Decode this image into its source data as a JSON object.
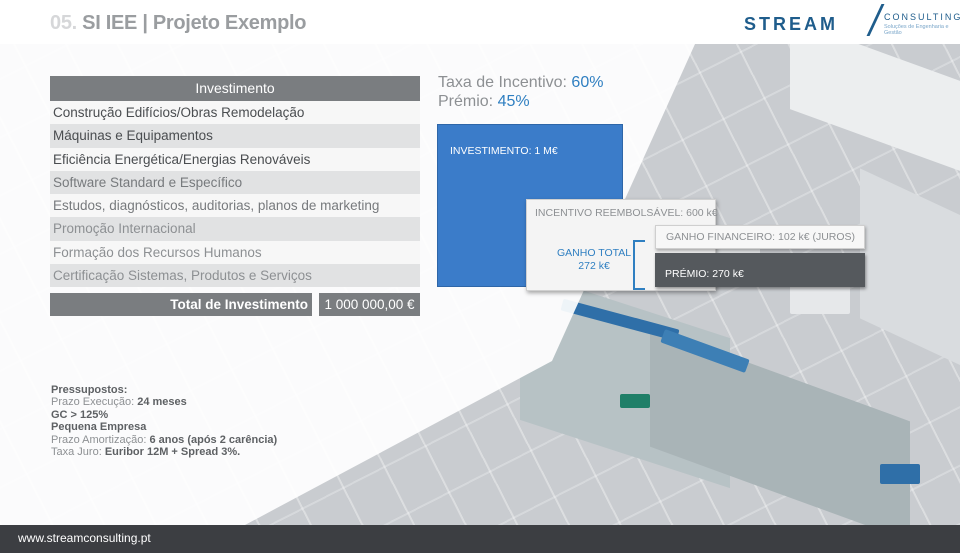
{
  "header": {
    "title_number": "05.",
    "title_text": "SI IEE | Projeto Exemplo",
    "logo_main": "STREAM",
    "logo_sub": "CONSULTING",
    "logo_tagline": "Soluções de Engenharia e Gestão"
  },
  "investment_table": {
    "heading": "Investimento",
    "rows": [
      "Construção Edifícios/Obras Remodelação",
      "Máquinas e Equipamentos",
      "Eficiência Energética/Energias Renováveis",
      "Software Standard e Específico",
      "Estudos, diagnósticos, auditorias, planos de marketing",
      "Promoção Internacional",
      "Formação dos Recursos Humanos",
      "Certificação Sistemas, Produtos e Serviços"
    ],
    "total_label": "Total de Investimento",
    "total_value": "1 000 000,00 €"
  },
  "incentive": {
    "taxa_label": "Taxa de Incentivo: ",
    "taxa_value": "60%",
    "premio_label": "Prémio: ",
    "premio_value": "45%"
  },
  "bars": {
    "investimento": "INVESTIMENTO: 1 M€",
    "incentivo": "INCENTIVO  REEMBOLSÁVEL: 600 k€",
    "ganho_total_line1": "GANHO TOTAL",
    "ganho_total_line2": "272 k€",
    "ganho_financeiro": "GANHO FINANCEIRO: 102 k€ (JUROS)",
    "premio": "PRÉMIO: 270 k€"
  },
  "pressupostos": {
    "title": "Pressupostos:",
    "prazo_label": "Prazo Execução: ",
    "prazo_value": "24 meses",
    "gc": "GC > 125%",
    "empresa": "Pequena Empresa",
    "amortizacao_label": "Prazo Amortização: ",
    "amortizacao_value": "6 anos (após 2 carência)",
    "taxa_label": "Taxa Juro: ",
    "taxa_value": "Euribor 12M + Spread 3%."
  },
  "footer": {
    "url": "www.streamconsulting.pt"
  },
  "colors": {
    "accent_blue": "#3b7cc9",
    "dark_grey": "#55595d",
    "footer_bg": "#3c3e42"
  }
}
